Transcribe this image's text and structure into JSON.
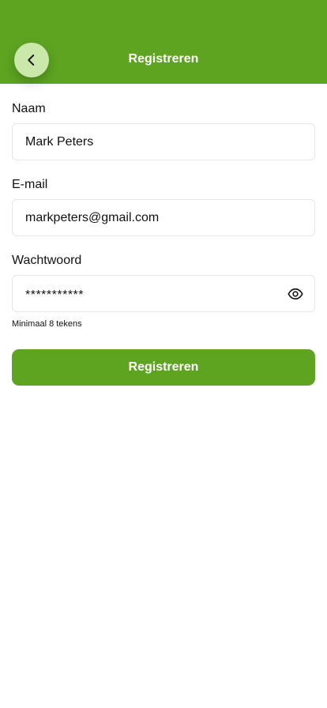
{
  "header": {
    "title": "Registreren",
    "back_icon": "chevron-left-icon"
  },
  "form": {
    "name": {
      "label": "Naam",
      "value": "Mark Peters"
    },
    "email": {
      "label": "E-mail",
      "value": "markpeters@gmail.com"
    },
    "password": {
      "label": "Wachtwoord",
      "masked_value": "***********",
      "visibility_icon": "eye-icon",
      "hint": "Minimaal 8 tekens"
    },
    "submit_label": "Registreren"
  },
  "colors": {
    "brand_green": "#5ea421",
    "back_button_bg": "#c9e8a9"
  }
}
